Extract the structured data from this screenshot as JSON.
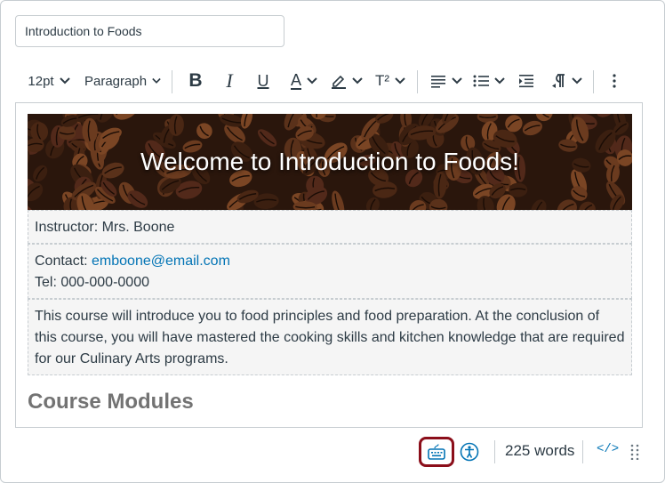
{
  "title_field": {
    "value": "Introduction to Foods"
  },
  "toolbar": {
    "font_size": "12pt",
    "block_format": "Paragraph",
    "bold": "B",
    "italic": "I",
    "underline": "U",
    "text_color": "A",
    "superscript": "T²"
  },
  "content": {
    "banner_text": "Welcome to Introduction to Foods!",
    "instructor": "Instructor:  Mrs. Boone",
    "contact_label": "Contact: ",
    "contact_email": "emboone@email.com",
    "tel": "Tel: 000-000-0000",
    "description": "This course will introduce you to food principles and food preparation. At the conclusion of this course, you will have mastered the cooking skills and kitchen knowledge that are required for our Culinary Arts programs.",
    "modules_heading": "Course Modules"
  },
  "status_bar": {
    "word_count": "225 words",
    "html_toggle": "</>"
  },
  "colors": {
    "highlight_border": "#8b0e1a",
    "link": "#0374b5",
    "text": "#2d3b45",
    "border": "#c7cdd1"
  }
}
